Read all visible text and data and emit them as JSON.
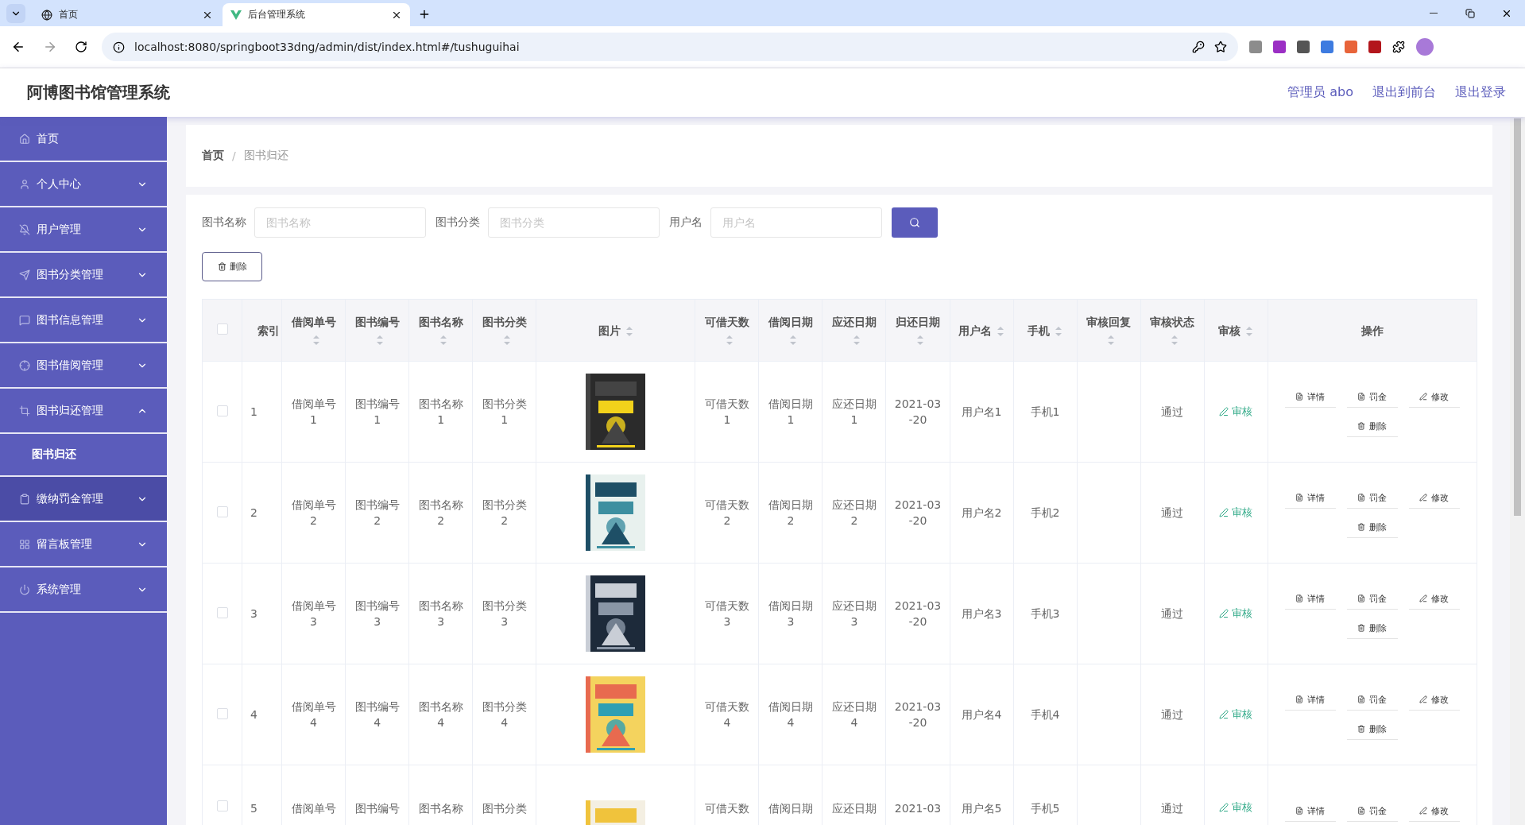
{
  "browser": {
    "tabs": [
      {
        "title": "首页",
        "selected": false
      },
      {
        "title": "后台管理系统",
        "selected": true
      }
    ],
    "url": "localhost:8080/springboot33dng/admin/dist/index.html#/tushuguihai"
  },
  "header": {
    "title": "阿博图书馆管理系统",
    "links": [
      "管理员 abo",
      "退出到前台",
      "退出登录"
    ]
  },
  "sidebar": {
    "items": [
      {
        "label": "首页",
        "kind": "link",
        "highlighted": false
      },
      {
        "label": "个人中心",
        "kind": "menu",
        "expanded": false,
        "highlighted": false
      },
      {
        "label": "用户管理",
        "kind": "menu",
        "expanded": false,
        "highlighted": false
      },
      {
        "label": "图书分类管理",
        "kind": "menu",
        "expanded": false,
        "highlighted": false
      },
      {
        "label": "图书信息管理",
        "kind": "menu",
        "expanded": false,
        "highlighted": false
      },
      {
        "label": "图书借阅管理",
        "kind": "menu",
        "expanded": false,
        "highlighted": false
      },
      {
        "label": "图书归还管理",
        "kind": "menu",
        "expanded": true,
        "highlighted": false,
        "children": [
          {
            "label": "图书归还",
            "selected": true
          }
        ]
      },
      {
        "label": "缴纳罚金管理",
        "kind": "menu",
        "expanded": false,
        "highlighted": true
      },
      {
        "label": "留言板管理",
        "kind": "menu",
        "expanded": false,
        "highlighted": false
      },
      {
        "label": "系统管理",
        "kind": "menu",
        "expanded": false,
        "highlighted": false
      }
    ]
  },
  "breadcrumb": {
    "separator": "/",
    "items": [
      "首页",
      "图书归还"
    ]
  },
  "search": {
    "fields": [
      {
        "label": "图书名称",
        "placeholder": "图书名称"
      },
      {
        "label": "图书分类",
        "placeholder": "图书分类"
      },
      {
        "label": "用户名",
        "placeholder": "用户名"
      }
    ]
  },
  "toolbar": {
    "delete_label": "删除"
  },
  "table": {
    "columns": [
      {
        "kind": "check",
        "checked": false
      },
      {
        "kind": "text",
        "label": "索引",
        "sortable": false
      },
      {
        "kind": "text",
        "label": "借阅单号",
        "sortable": true
      },
      {
        "kind": "text",
        "label": "图书编号",
        "sortable": true
      },
      {
        "kind": "text",
        "label": "图书名称",
        "sortable": true
      },
      {
        "kind": "text",
        "label": "图书分类",
        "sortable": true
      },
      {
        "kind": "picture",
        "label": "图片",
        "sortable": true
      },
      {
        "kind": "text",
        "label": "可借天数",
        "sortable": true
      },
      {
        "kind": "text",
        "label": "借阅日期",
        "sortable": true
      },
      {
        "kind": "text",
        "label": "应还日期",
        "sortable": true
      },
      {
        "kind": "date",
        "label": "归还日期",
        "sortable": true
      },
      {
        "kind": "text",
        "label": "用户名",
        "sortable": true
      },
      {
        "kind": "text",
        "label": "手机",
        "sortable": true
      },
      {
        "kind": "text",
        "label": "审核回复",
        "sortable": true
      },
      {
        "kind": "text",
        "label": "审核状态",
        "sortable": true
      },
      {
        "kind": "audit",
        "label": "审核",
        "sortable": true
      },
      {
        "kind": "actions",
        "label": "操作",
        "sortable": false
      }
    ],
    "rows": [
      {
        "checked": false,
        "cells": [
          null,
          "1",
          "借阅单号1",
          "图书编号1",
          "图书名称1",
          "图书分类1",
          null,
          "可借天数1",
          "借阅日期1",
          "应还日期1",
          "2021-03-20",
          "用户名1",
          "手机1",
          null,
          "通过",
          "审核",
          [
            "详情",
            "罚金",
            "修改",
            "删除"
          ]
        ]
      },
      {
        "checked": false,
        "cells": [
          null,
          "2",
          "借阅单号2",
          "图书编号2",
          "图书名称2",
          "图书分类2",
          null,
          "可借天数2",
          "借阅日期2",
          "应还日期2",
          "2021-03-20",
          "用户名2",
          "手机2",
          null,
          "通过",
          "审核",
          [
            "详情",
            "罚金",
            "修改",
            "删除"
          ]
        ]
      },
      {
        "checked": false,
        "cells": [
          null,
          "3",
          "借阅单号3",
          "图书编号3",
          "图书名称3",
          "图书分类3",
          null,
          "可借天数3",
          "借阅日期3",
          "应还日期3",
          "2021-03-20",
          "用户名3",
          "手机3",
          null,
          "通过",
          "审核",
          [
            "详情",
            "罚金",
            "修改",
            "删除"
          ]
        ]
      },
      {
        "checked": false,
        "cells": [
          null,
          "4",
          "借阅单号4",
          "图书编号4",
          "图书名称4",
          "图书分类4",
          null,
          "可借天数4",
          "借阅日期4",
          "应还日期4",
          "2021-03-20",
          "用户名4",
          "手机4",
          null,
          "通过",
          "审核",
          [
            "详情",
            "罚金",
            "修改",
            "删除"
          ]
        ]
      },
      {
        "checked": false,
        "cells": [
          null,
          "5",
          "借阅单号",
          "图书编号",
          "图书名称",
          "图书分类",
          null,
          "可借天数",
          "借阅日期",
          "应还日期",
          "2021-03",
          "用户名5",
          "手机5",
          null,
          "通过",
          "审核",
          [
            "详情",
            "罚金",
            "修改"
          ]
        ]
      }
    ]
  }
}
